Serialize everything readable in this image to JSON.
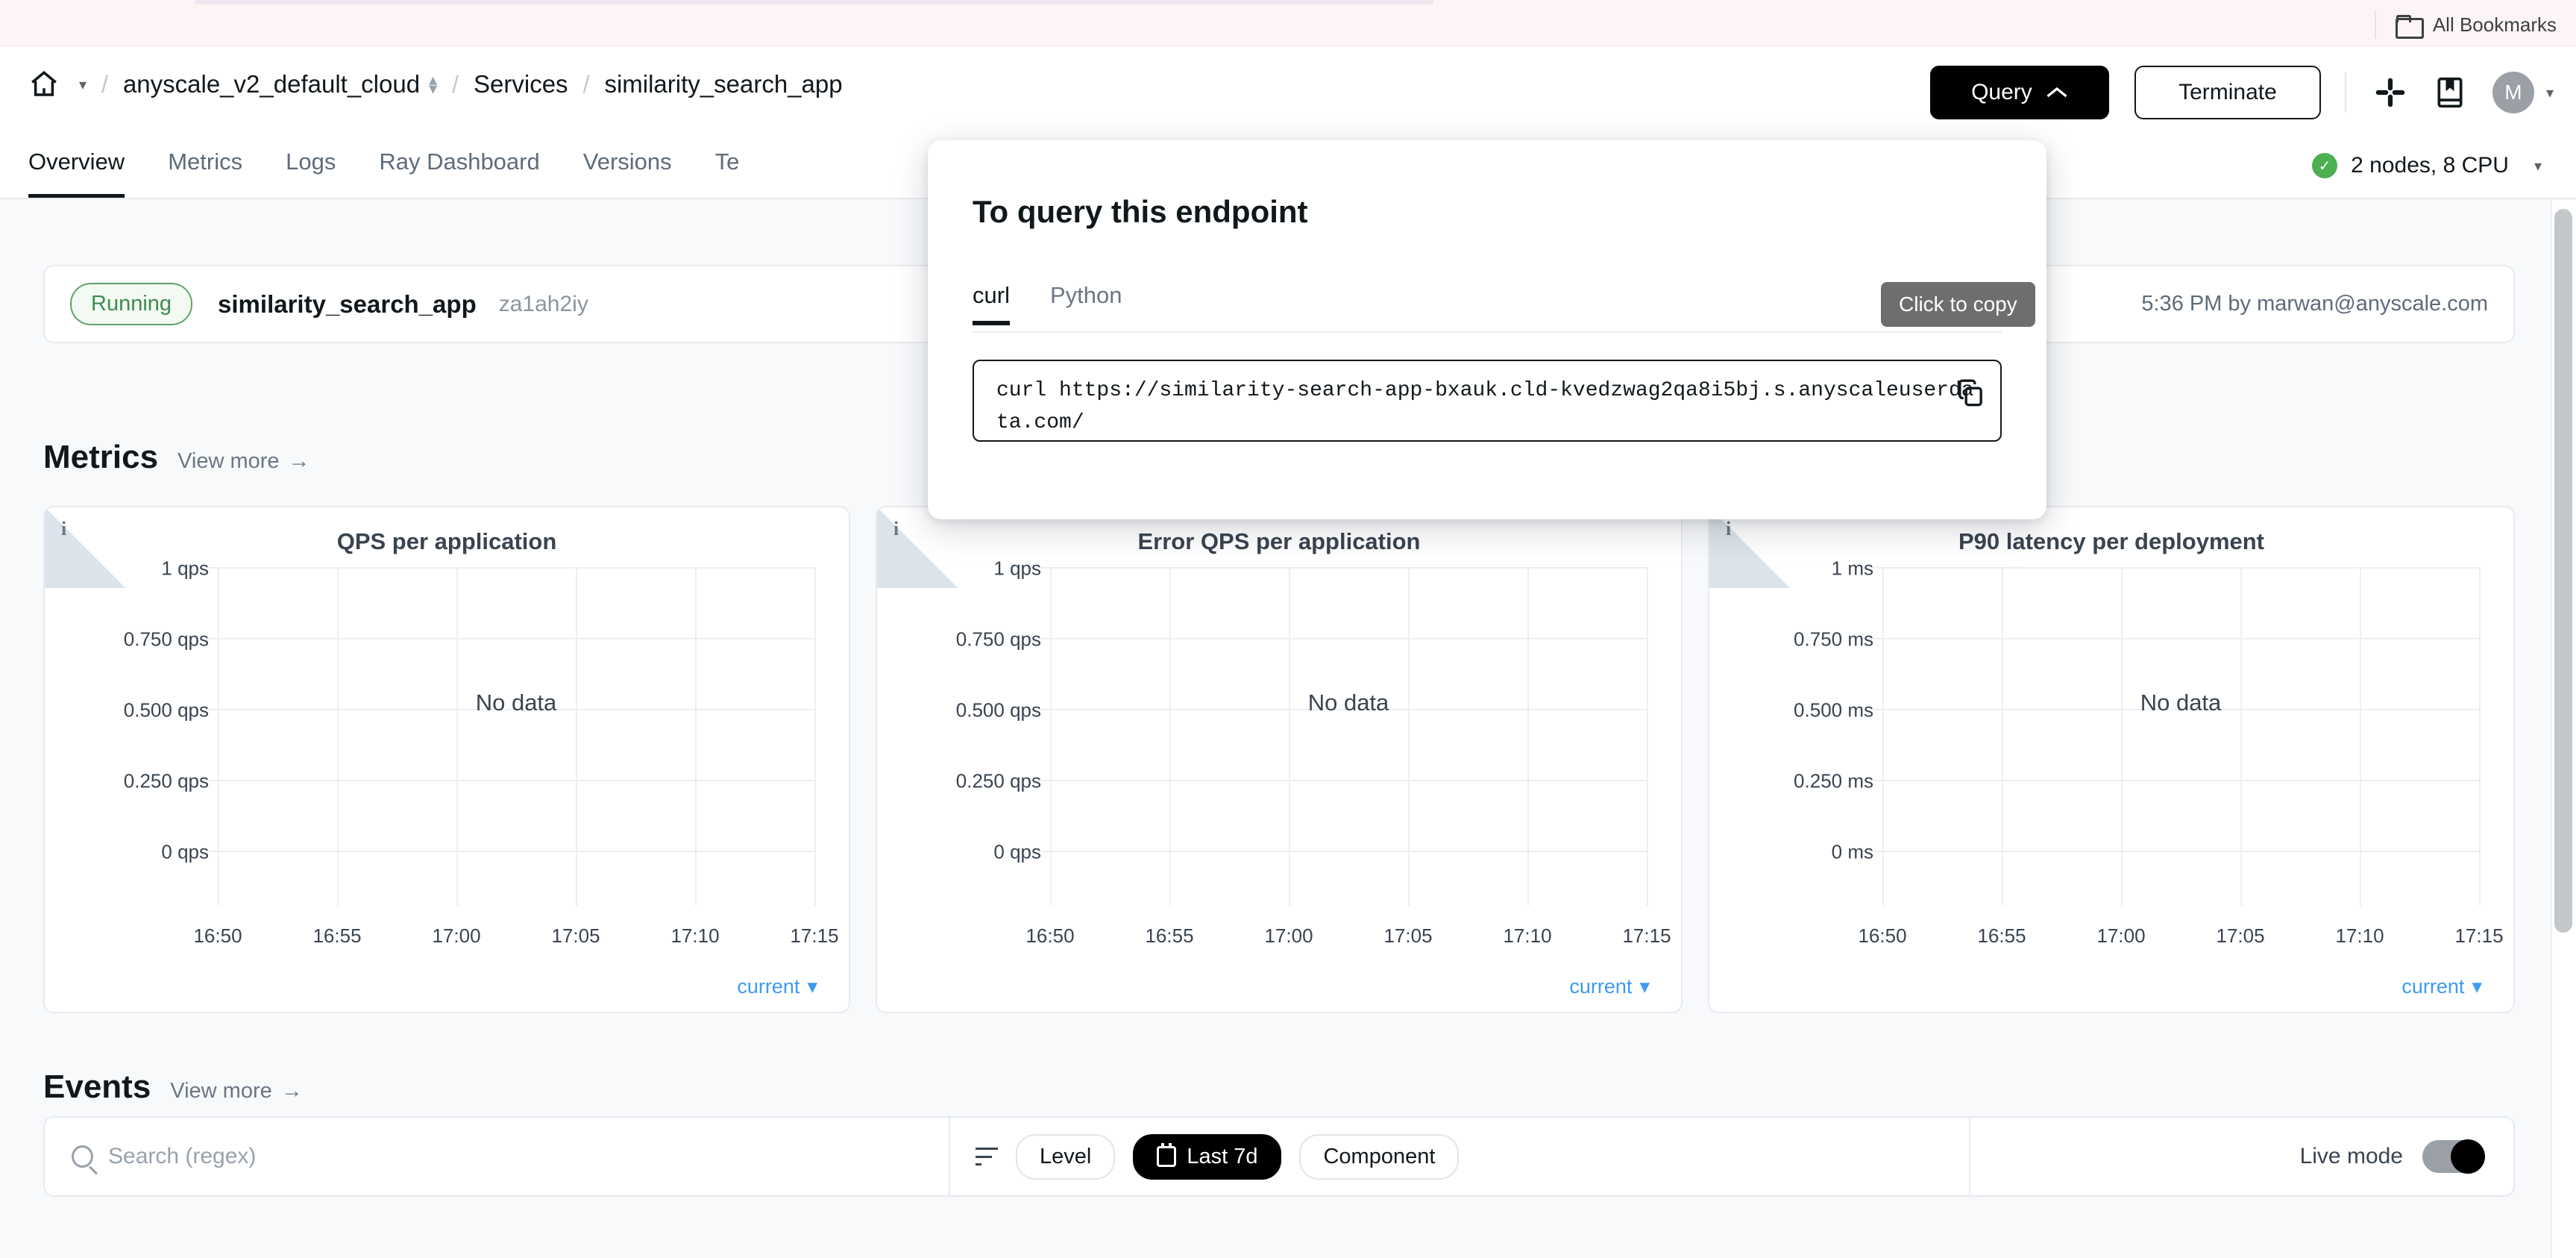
{
  "browser": {
    "bookmarks_label": "All Bookmarks",
    "folder_icon": "folder-icon"
  },
  "header": {
    "home_icon": "home-icon",
    "breadcrumb": {
      "cloud": "anyscale_v2_default_cloud",
      "section": "Services",
      "current": "similarity_search_app",
      "separator": "/"
    },
    "query_button": "Query",
    "query_caret": "⌃",
    "terminate_button": "Terminate",
    "slack_icon": "slack-icon",
    "docs_icon": "docs-icon",
    "avatar_initial": "M"
  },
  "tabs": [
    {
      "label": "Overview",
      "active": true
    },
    {
      "label": "Metrics",
      "active": false
    },
    {
      "label": "Logs",
      "active": false
    },
    {
      "label": "Ray Dashboard",
      "active": false
    },
    {
      "label": "Versions",
      "active": false
    },
    {
      "label": "Te",
      "active": false
    }
  ],
  "cluster_status": {
    "label": "2 nodes, 8 CPU",
    "state": "ok",
    "color": "#4caf50"
  },
  "service_status": {
    "badge": "Running",
    "badge_color": "#3e8a50",
    "name": "similarity_search_app",
    "id": "za1ah2iy",
    "updated": "5:36 PM by marwan@anyscale.com"
  },
  "metrics_section": {
    "title": "Metrics",
    "view_more": "View more",
    "arrow": "→"
  },
  "chart_data": [
    {
      "type": "line",
      "title": "QPS per application",
      "empty_message": "No data",
      "info_icon": "info-icon",
      "ylabel": "",
      "xlabel": "",
      "ylim": [
        0,
        1
      ],
      "yticks": [
        "0 qps",
        "0.250 qps",
        "0.500 qps",
        "0.750 qps",
        "1 qps"
      ],
      "ytick_values": [
        0,
        0.25,
        0.5,
        0.75,
        1
      ],
      "xticks": [
        "16:50",
        "16:55",
        "17:00",
        "17:05",
        "17:10",
        "17:15"
      ],
      "series": [],
      "grid": true,
      "legend": "current",
      "legend_position": "bottom-right"
    },
    {
      "type": "line",
      "title": "Error QPS per application",
      "empty_message": "No data",
      "info_icon": "info-icon",
      "ylabel": "",
      "xlabel": "",
      "ylim": [
        0,
        1
      ],
      "yticks": [
        "0 qps",
        "0.250 qps",
        "0.500 qps",
        "0.750 qps",
        "1 qps"
      ],
      "ytick_values": [
        0,
        0.25,
        0.5,
        0.75,
        1
      ],
      "xticks": [
        "16:50",
        "16:55",
        "17:00",
        "17:05",
        "17:10",
        "17:15"
      ],
      "series": [],
      "grid": true,
      "legend": "current",
      "legend_position": "bottom-right"
    },
    {
      "type": "line",
      "title": "P90 latency per deployment",
      "empty_message": "No data",
      "info_icon": "info-icon",
      "ylabel": "",
      "xlabel": "",
      "ylim": [
        0,
        1
      ],
      "yticks": [
        "0 ms",
        "0.250 ms",
        "0.500 ms",
        "0.750 ms",
        "1 ms"
      ],
      "ytick_values": [
        0,
        0.25,
        0.5,
        0.75,
        1
      ],
      "xticks": [
        "16:50",
        "16:55",
        "17:00",
        "17:05",
        "17:10",
        "17:15"
      ],
      "series": [],
      "grid": true,
      "legend": "current",
      "legend_position": "bottom-right"
    }
  ],
  "events_section": {
    "title": "Events",
    "view_more": "View more",
    "arrow": "→",
    "search_placeholder": "Search (regex)",
    "search_value": "",
    "filter_icon": "filter-icon",
    "chips": [
      {
        "label": "Level",
        "active": false
      },
      {
        "label": "Last 7d",
        "active": true,
        "icon": "calendar-icon"
      },
      {
        "label": "Component",
        "active": false
      }
    ],
    "live_mode_label": "Live mode",
    "live_mode_on": true
  },
  "query_popup": {
    "title": "To query this endpoint",
    "tabs": [
      {
        "label": "curl",
        "active": true
      },
      {
        "label": "Python",
        "active": false
      }
    ],
    "code": "curl https://similarity-search-app-bxauk.cld-kvedzwag2qa8i5bj.s.anyscaleuserdata.com/",
    "copy_icon": "copy-icon",
    "tooltip": "Click to copy"
  }
}
